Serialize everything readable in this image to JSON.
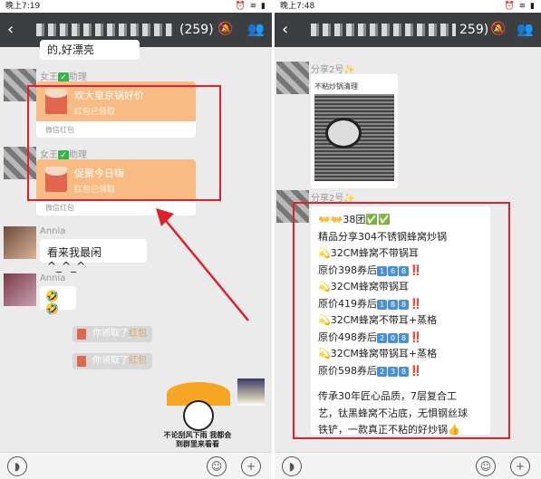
{
  "left": {
    "status_time": "晚上7:19",
    "title_count": "(259)",
    "messages": {
      "top_partial_text": "的,好漂亮",
      "rp1_sender": "女王",
      "rp1_role": "助理",
      "rp1_text": "欢大皇京锅好价",
      "rp1_status": "红包已领取",
      "rp1_footer": "微信红包",
      "rp2_sender": "女王",
      "rp2_role": "助理",
      "rp2_text": "促聚今日嗨",
      "rp2_status": "红包已领取",
      "rp2_footer": "微信红包",
      "annia_name": "Annia",
      "annia_msg1": "看来我最闲^_^_^",
      "annia_msg2": "🤣🤣",
      "notice1_text": "你领取了",
      "notice1_link": "红包",
      "notice2_text": "你领取了",
      "notice2_link": "红包",
      "sticker_caption": "不论刮风下雨 我都会到群里来看看"
    }
  },
  "right": {
    "status_time": "晚上7:48",
    "title_count": "259)",
    "share_name_1": "分享2号✨",
    "card_title": "不粘炒锅清理",
    "share_name_2": "分享2号✨",
    "promo": {
      "header": "👐👐38团✅✅",
      "line1": "精品分享304不锈钢蜂窝炒锅",
      "line2": "💫32CM蜂窝不带锅耳",
      "line3_prefix": "原价398券后",
      "line3_digits": [
        "1",
        "6",
        "8"
      ],
      "line4": "💫32CM蜂窝带锅耳",
      "line5_prefix": "原价419券后",
      "line5_digits": [
        "1",
        "8",
        "8"
      ],
      "line6": "💫32CM蜂窝不带耳+蒸格",
      "line7_prefix": "原价498券后",
      "line7_digits": [
        "2",
        "0",
        "8"
      ],
      "line8": "💫32CM蜂窝带锅耳+蒸格",
      "line9_prefix": "原价598券后",
      "line9_digits": [
        "2",
        "3",
        "8"
      ],
      "bang": "‼️",
      "para1": "传承30年匠心品质，7层复合工",
      "para2": "艺，钛黑蜂窝不沾底，无惧钢丝球",
      "para3": "铁铲，一款真正不粘的好炒锅👍"
    }
  },
  "colors": {
    "title_bar": "#3c3f41",
    "chat_bg": "#ebebeb",
    "red_packet": "#f8bb84",
    "highlight": "#e0202a",
    "number_badge": "#4a90d9"
  },
  "icons": [
    "back-icon",
    "mute-icon",
    "group-members-icon",
    "voice-icon",
    "emoji-icon",
    "plus-icon",
    "red-packet-icon",
    "wifi-icon",
    "battery-icon"
  ]
}
